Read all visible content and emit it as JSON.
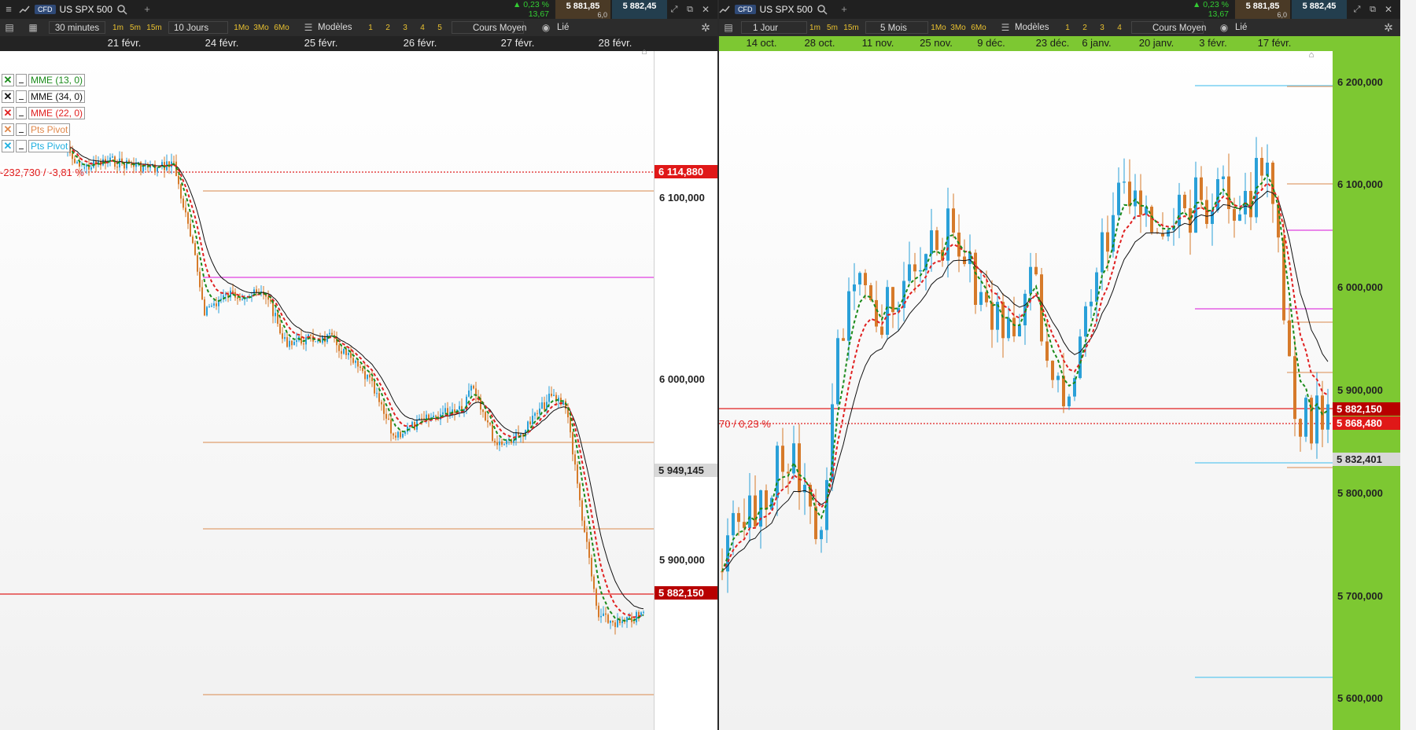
{
  "left": {
    "tab": {
      "cfd": "CFD",
      "title": "US SPX 500"
    },
    "change": {
      "pct": "0,23 %",
      "abs": "13,67"
    },
    "sell": {
      "price": "5 881,85"
    },
    "spread": "6,0",
    "buy": {
      "price": "5 882,45"
    },
    "toolbar": {
      "interval": "30 minutes",
      "quick_intervals": [
        "1m",
        "5m",
        "15m"
      ],
      "period": "10 Jours",
      "quick_periods": [
        "1Mo",
        "3Mo",
        "6Mo"
      ],
      "models": "Modèles",
      "slots": [
        "1",
        "2",
        "3",
        "4",
        "5"
      ],
      "price_type": "Cours Moyen",
      "linked": "Lié"
    },
    "date_ticks": [
      "21 févr.",
      "24 févr.",
      "25 févr.",
      "26 févr.",
      "27 févr.",
      "28 févr."
    ],
    "y_labels": [
      "6 100,000",
      "6 000,000",
      "5 900,000"
    ],
    "tags": {
      "high": "6 114,880",
      "mid": "5 949,145",
      "last": "5 882,150"
    },
    "change_note": "-232,730 / -3,81 %",
    "legend": [
      {
        "name": "MME (13, 0)",
        "color": "#1a8a1a"
      },
      {
        "name": "MME (34, 0)",
        "color": "#111111"
      },
      {
        "name": "MME (22, 0)",
        "color": "#e02020"
      },
      {
        "name": "Pts Pivot",
        "color": "#e0884a"
      },
      {
        "name": "Pts Pivot",
        "color": "#20b0e0"
      }
    ]
  },
  "right": {
    "tab": {
      "cfd": "CFD",
      "title": "US SPX 500"
    },
    "change": {
      "pct": "0,23 %",
      "abs": "13,67"
    },
    "sell": {
      "price": "5 881,85"
    },
    "spread": "6,0",
    "buy": {
      "price": "5 882,45"
    },
    "toolbar": {
      "interval": "1 Jour",
      "quick_intervals": [
        "1m",
        "5m",
        "15m"
      ],
      "period": "5 Mois",
      "quick_periods": [
        "1Mo",
        "3Mo",
        "6Mo"
      ],
      "models": "Modèles",
      "slots": [
        "1",
        "2",
        "3",
        "4"
      ],
      "price_type": "Cours Moyen",
      "linked": "Lié"
    },
    "date_ticks": [
      "14 oct.",
      "28 oct.",
      "11 nov.",
      "25 nov.",
      "9 déc.",
      "23 déc.",
      "6 janv.",
      "20 janv.",
      "3 févr.",
      "17 févr."
    ],
    "y_labels": [
      "6 200,000",
      "6 100,000",
      "6 000,000",
      "5 900,000",
      "5 800,000",
      "5 700,000",
      "5 600,000"
    ],
    "tags": {
      "last": "5 882,150",
      "bid": "5 868,480",
      "pivot": "5 832,401"
    },
    "change_note": "70 / 0,23 %"
  },
  "colors": {
    "up": "#2aa0d8",
    "down": "#d67a2a",
    "ema13": "#1a8a1a",
    "ema22": "#e02020",
    "ema34": "#111111",
    "pivot_orange": "#e0a070",
    "pivot_magenta": "#e040e0",
    "pivot_blue": "#60c8f0",
    "price_red": "#b80000",
    "axis_green": "#7dc832"
  },
  "icons": [
    "menu-icon",
    "chart-icon",
    "search-icon",
    "plus-icon",
    "triangle-up-icon",
    "expand-icon",
    "popout-icon",
    "close-icon",
    "settings-icon",
    "eye-icon",
    "templates-icon",
    "layout-icon",
    "home-icon"
  ]
}
